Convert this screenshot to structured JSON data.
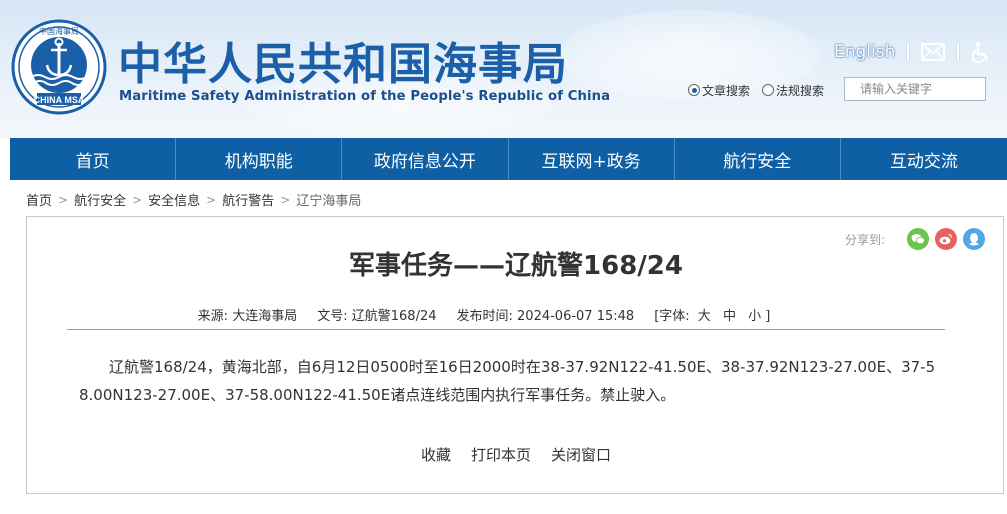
{
  "header": {
    "logo_ring_text": "中国海事局",
    "logo_bottom_text": "CHINA MSA",
    "title_cn": "中华人民共和国海事局",
    "title_en": "Maritime Safety Administration of the People's Republic of China",
    "english_link": "English",
    "search": {
      "option_article": "文章搜索",
      "option_law": "法规搜索",
      "selected": "文章搜索",
      "placeholder": "请输入关键字"
    },
    "icons": [
      "mail-icon",
      "accessibility-icon"
    ]
  },
  "nav": {
    "items": [
      "首页",
      "机构职能",
      "政府信息公开",
      "互联网+政务",
      "航行安全",
      "互动交流"
    ]
  },
  "breadcrumb": {
    "items": [
      "首页",
      "航行安全",
      "安全信息",
      "航行警告"
    ],
    "current": "辽宁海事局"
  },
  "article": {
    "share_label": "分享到:",
    "title": "军事任务——辽航警168/24",
    "source_label": "来源:",
    "source": "大连海事局",
    "doc_no_label": "文号:",
    "doc_no": "辽航警168/24",
    "date_label": "发布时间:",
    "date": "2024-06-07 15:48",
    "font_label": "[字体:",
    "font_large": "大",
    "font_medium": "中",
    "font_small": "小 ]",
    "body": "辽航警168/24，黄海北部，自6月12日0500时至16日2000时在38-37.92N122-41.50E、38-37.92N123-27.00E、37-58.00N123-27.00E、37-58.00N122-41.50E诸点连线范围内执行军事任务。禁止驶入。",
    "actions": {
      "favorite": "收藏",
      "print": "打印本页",
      "close": "关闭窗口"
    }
  },
  "colors": {
    "brand_blue": "#1a5fa8",
    "nav_blue": "#0f5fa4",
    "wechat_green": "#6cc44f",
    "weibo_red": "#e5635f",
    "qq_blue": "#4fa7e8"
  }
}
